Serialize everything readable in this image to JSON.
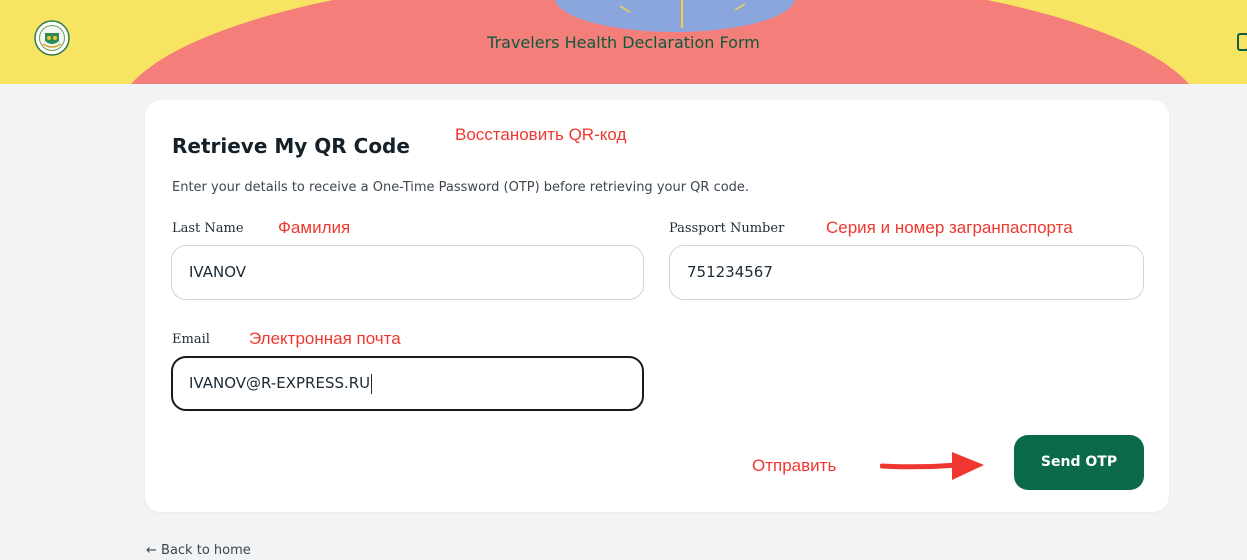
{
  "header": {
    "title": "Travelers Health Declaration Form",
    "logo_icon": "health-seal-logo-icon",
    "colors": {
      "yellow": "#f7e463",
      "salmon": "#f47e7a",
      "blue": "#8aa6dc",
      "title": "#0d5a3b"
    }
  },
  "form": {
    "title": "Retrieve My QR Code",
    "description": "Enter your details to receive a One-Time Password (OTP) before retrieving your QR code.",
    "last_name": {
      "label": "Last Name",
      "value": "IVANOV"
    },
    "passport_number": {
      "label": "Passport Number",
      "value": "751234567"
    },
    "email": {
      "label": "Email",
      "value": "IVANOV@R-EXPRESS.RU"
    },
    "submit_label": "Send OTP",
    "accent_color": "#0b6a47"
  },
  "annotations": {
    "title": "Восстановить QR-код",
    "last_name": "Фамилия",
    "passport": "Серия и номер загранпаспорта",
    "email": "Электронная почта",
    "submit": "Отправить",
    "color": "#f0372f"
  },
  "footer": {
    "back_link": "← Back to home"
  }
}
